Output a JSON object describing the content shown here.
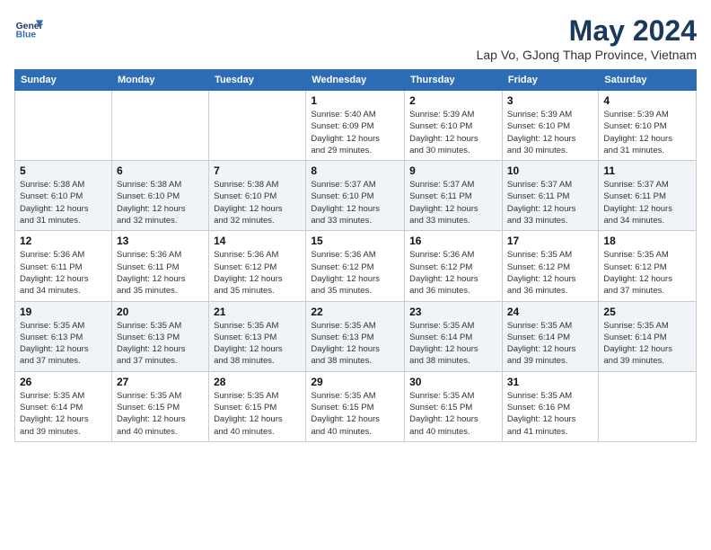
{
  "header": {
    "logo_line1": "General",
    "logo_line2": "Blue",
    "month_title": "May 2024",
    "location": "Lap Vo, GJong Thap Province, Vietnam"
  },
  "days_of_week": [
    "Sunday",
    "Monday",
    "Tuesday",
    "Wednesday",
    "Thursday",
    "Friday",
    "Saturday"
  ],
  "weeks": [
    [
      {
        "day": "",
        "content": ""
      },
      {
        "day": "",
        "content": ""
      },
      {
        "day": "",
        "content": ""
      },
      {
        "day": "1",
        "content": "Sunrise: 5:40 AM\nSunset: 6:09 PM\nDaylight: 12 hours\nand 29 minutes."
      },
      {
        "day": "2",
        "content": "Sunrise: 5:39 AM\nSunset: 6:10 PM\nDaylight: 12 hours\nand 30 minutes."
      },
      {
        "day": "3",
        "content": "Sunrise: 5:39 AM\nSunset: 6:10 PM\nDaylight: 12 hours\nand 30 minutes."
      },
      {
        "day": "4",
        "content": "Sunrise: 5:39 AM\nSunset: 6:10 PM\nDaylight: 12 hours\nand 31 minutes."
      }
    ],
    [
      {
        "day": "5",
        "content": "Sunrise: 5:38 AM\nSunset: 6:10 PM\nDaylight: 12 hours\nand 31 minutes."
      },
      {
        "day": "6",
        "content": "Sunrise: 5:38 AM\nSunset: 6:10 PM\nDaylight: 12 hours\nand 32 minutes."
      },
      {
        "day": "7",
        "content": "Sunrise: 5:38 AM\nSunset: 6:10 PM\nDaylight: 12 hours\nand 32 minutes."
      },
      {
        "day": "8",
        "content": "Sunrise: 5:37 AM\nSunset: 6:10 PM\nDaylight: 12 hours\nand 33 minutes."
      },
      {
        "day": "9",
        "content": "Sunrise: 5:37 AM\nSunset: 6:11 PM\nDaylight: 12 hours\nand 33 minutes."
      },
      {
        "day": "10",
        "content": "Sunrise: 5:37 AM\nSunset: 6:11 PM\nDaylight: 12 hours\nand 33 minutes."
      },
      {
        "day": "11",
        "content": "Sunrise: 5:37 AM\nSunset: 6:11 PM\nDaylight: 12 hours\nand 34 minutes."
      }
    ],
    [
      {
        "day": "12",
        "content": "Sunrise: 5:36 AM\nSunset: 6:11 PM\nDaylight: 12 hours\nand 34 minutes."
      },
      {
        "day": "13",
        "content": "Sunrise: 5:36 AM\nSunset: 6:11 PM\nDaylight: 12 hours\nand 35 minutes."
      },
      {
        "day": "14",
        "content": "Sunrise: 5:36 AM\nSunset: 6:12 PM\nDaylight: 12 hours\nand 35 minutes."
      },
      {
        "day": "15",
        "content": "Sunrise: 5:36 AM\nSunset: 6:12 PM\nDaylight: 12 hours\nand 35 minutes."
      },
      {
        "day": "16",
        "content": "Sunrise: 5:36 AM\nSunset: 6:12 PM\nDaylight: 12 hours\nand 36 minutes."
      },
      {
        "day": "17",
        "content": "Sunrise: 5:35 AM\nSunset: 6:12 PM\nDaylight: 12 hours\nand 36 minutes."
      },
      {
        "day": "18",
        "content": "Sunrise: 5:35 AM\nSunset: 6:12 PM\nDaylight: 12 hours\nand 37 minutes."
      }
    ],
    [
      {
        "day": "19",
        "content": "Sunrise: 5:35 AM\nSunset: 6:13 PM\nDaylight: 12 hours\nand 37 minutes."
      },
      {
        "day": "20",
        "content": "Sunrise: 5:35 AM\nSunset: 6:13 PM\nDaylight: 12 hours\nand 37 minutes."
      },
      {
        "day": "21",
        "content": "Sunrise: 5:35 AM\nSunset: 6:13 PM\nDaylight: 12 hours\nand 38 minutes."
      },
      {
        "day": "22",
        "content": "Sunrise: 5:35 AM\nSunset: 6:13 PM\nDaylight: 12 hours\nand 38 minutes."
      },
      {
        "day": "23",
        "content": "Sunrise: 5:35 AM\nSunset: 6:14 PM\nDaylight: 12 hours\nand 38 minutes."
      },
      {
        "day": "24",
        "content": "Sunrise: 5:35 AM\nSunset: 6:14 PM\nDaylight: 12 hours\nand 39 minutes."
      },
      {
        "day": "25",
        "content": "Sunrise: 5:35 AM\nSunset: 6:14 PM\nDaylight: 12 hours\nand 39 minutes."
      }
    ],
    [
      {
        "day": "26",
        "content": "Sunrise: 5:35 AM\nSunset: 6:14 PM\nDaylight: 12 hours\nand 39 minutes."
      },
      {
        "day": "27",
        "content": "Sunrise: 5:35 AM\nSunset: 6:15 PM\nDaylight: 12 hours\nand 40 minutes."
      },
      {
        "day": "28",
        "content": "Sunrise: 5:35 AM\nSunset: 6:15 PM\nDaylight: 12 hours\nand 40 minutes."
      },
      {
        "day": "29",
        "content": "Sunrise: 5:35 AM\nSunset: 6:15 PM\nDaylight: 12 hours\nand 40 minutes."
      },
      {
        "day": "30",
        "content": "Sunrise: 5:35 AM\nSunset: 6:15 PM\nDaylight: 12 hours\nand 40 minutes."
      },
      {
        "day": "31",
        "content": "Sunrise: 5:35 AM\nSunset: 6:16 PM\nDaylight: 12 hours\nand 41 minutes."
      },
      {
        "day": "",
        "content": ""
      }
    ]
  ]
}
